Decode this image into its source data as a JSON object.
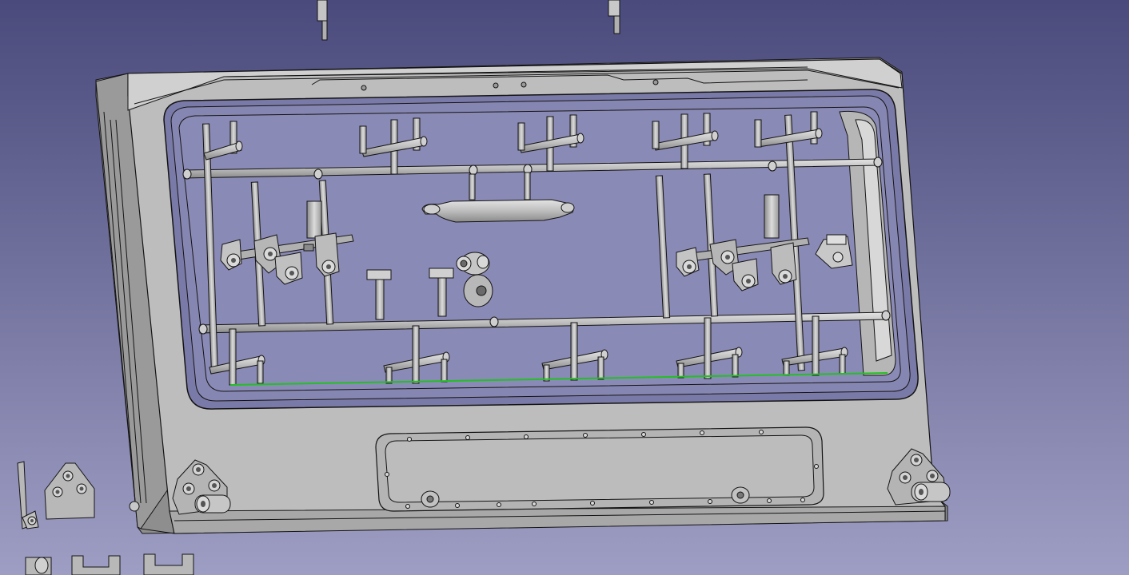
{
  "viewport": {
    "background_top": "#4a4a7c",
    "background_bottom": "#9e9ec4",
    "model_face": "#bdbdbd",
    "model_face_light": "#d2d2d2",
    "model_face_dark": "#8e8e8e",
    "edge_color": "#141414",
    "selection_highlight": "#22c022"
  },
  "objects": [
    {
      "name": "window-frame",
      "icon": "frame-part"
    },
    {
      "name": "sprue-tree",
      "icon": "sprue-part"
    },
    {
      "name": "lower-access-panel",
      "icon": "panel-part"
    },
    {
      "name": "hinge-left",
      "icon": "hinge-part"
    },
    {
      "name": "hinge-right",
      "icon": "hinge-part"
    },
    {
      "name": "loose-parts",
      "icon": "part"
    }
  ]
}
